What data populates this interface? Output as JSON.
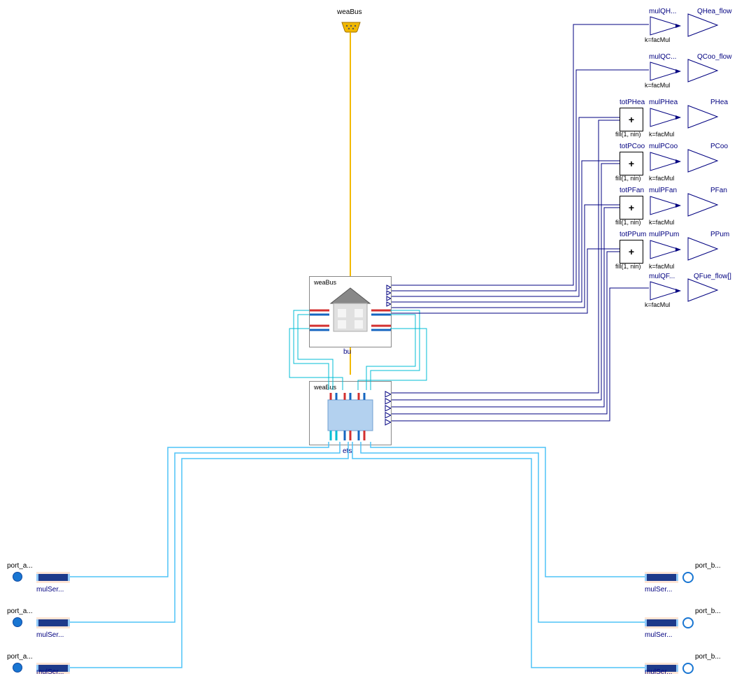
{
  "top": {
    "weaBus_label": "weaBus"
  },
  "building": {
    "weaBus_label": "weaBus",
    "name": "bu"
  },
  "ets": {
    "weaBus_label": "weaBus",
    "name": "ets"
  },
  "outputs": {
    "QHea_flow": {
      "mul_label": "mulQH...",
      "out_label": "QHea_flow",
      "k_label": "k=facMul"
    },
    "QCoo_flow": {
      "mul_label": "mulQC...",
      "out_label": "QCoo_flow",
      "k_label": "k=facMul"
    },
    "PHea": {
      "tot_label": "totPHea",
      "mul_label": "mulPHea",
      "out_label": "PHea",
      "k_label": "k=facMul",
      "fill_label": "fill(1, nin)"
    },
    "PCoo": {
      "tot_label": "totPCoo",
      "mul_label": "mulPCoo",
      "out_label": "PCoo",
      "k_label": "k=facMul",
      "fill_label": "fill(1, nin)"
    },
    "PFan": {
      "tot_label": "totPFan",
      "mul_label": "mulPFan",
      "out_label": "PFan",
      "k_label": "k=facMul",
      "fill_label": "fill(1, nin)"
    },
    "PPum": {
      "tot_label": "totPPum",
      "mul_label": "mulPPum",
      "out_label": "PPum",
      "k_label": "k=facMul",
      "fill_label": "fill(1, nin)"
    },
    "QFue_flow": {
      "mul_label": "mulQF...",
      "out_label": "QFue_flow[]",
      "k_label": "k=facMul"
    }
  },
  "ports": {
    "left": [
      {
        "port_label": "port_a...",
        "mul_label": "mulSer..."
      },
      {
        "port_label": "port_a...",
        "mul_label": "mulSer..."
      },
      {
        "port_label": "port_a...",
        "mul_label": "mulSer..."
      }
    ],
    "right": [
      {
        "port_label": "port_b...",
        "mul_label": "mulSer..."
      },
      {
        "port_label": "port_b...",
        "mul_label": "mulSer..."
      },
      {
        "port_label": "port_b...",
        "mul_label": "mulSer..."
      }
    ]
  },
  "sum_symbol": "+"
}
